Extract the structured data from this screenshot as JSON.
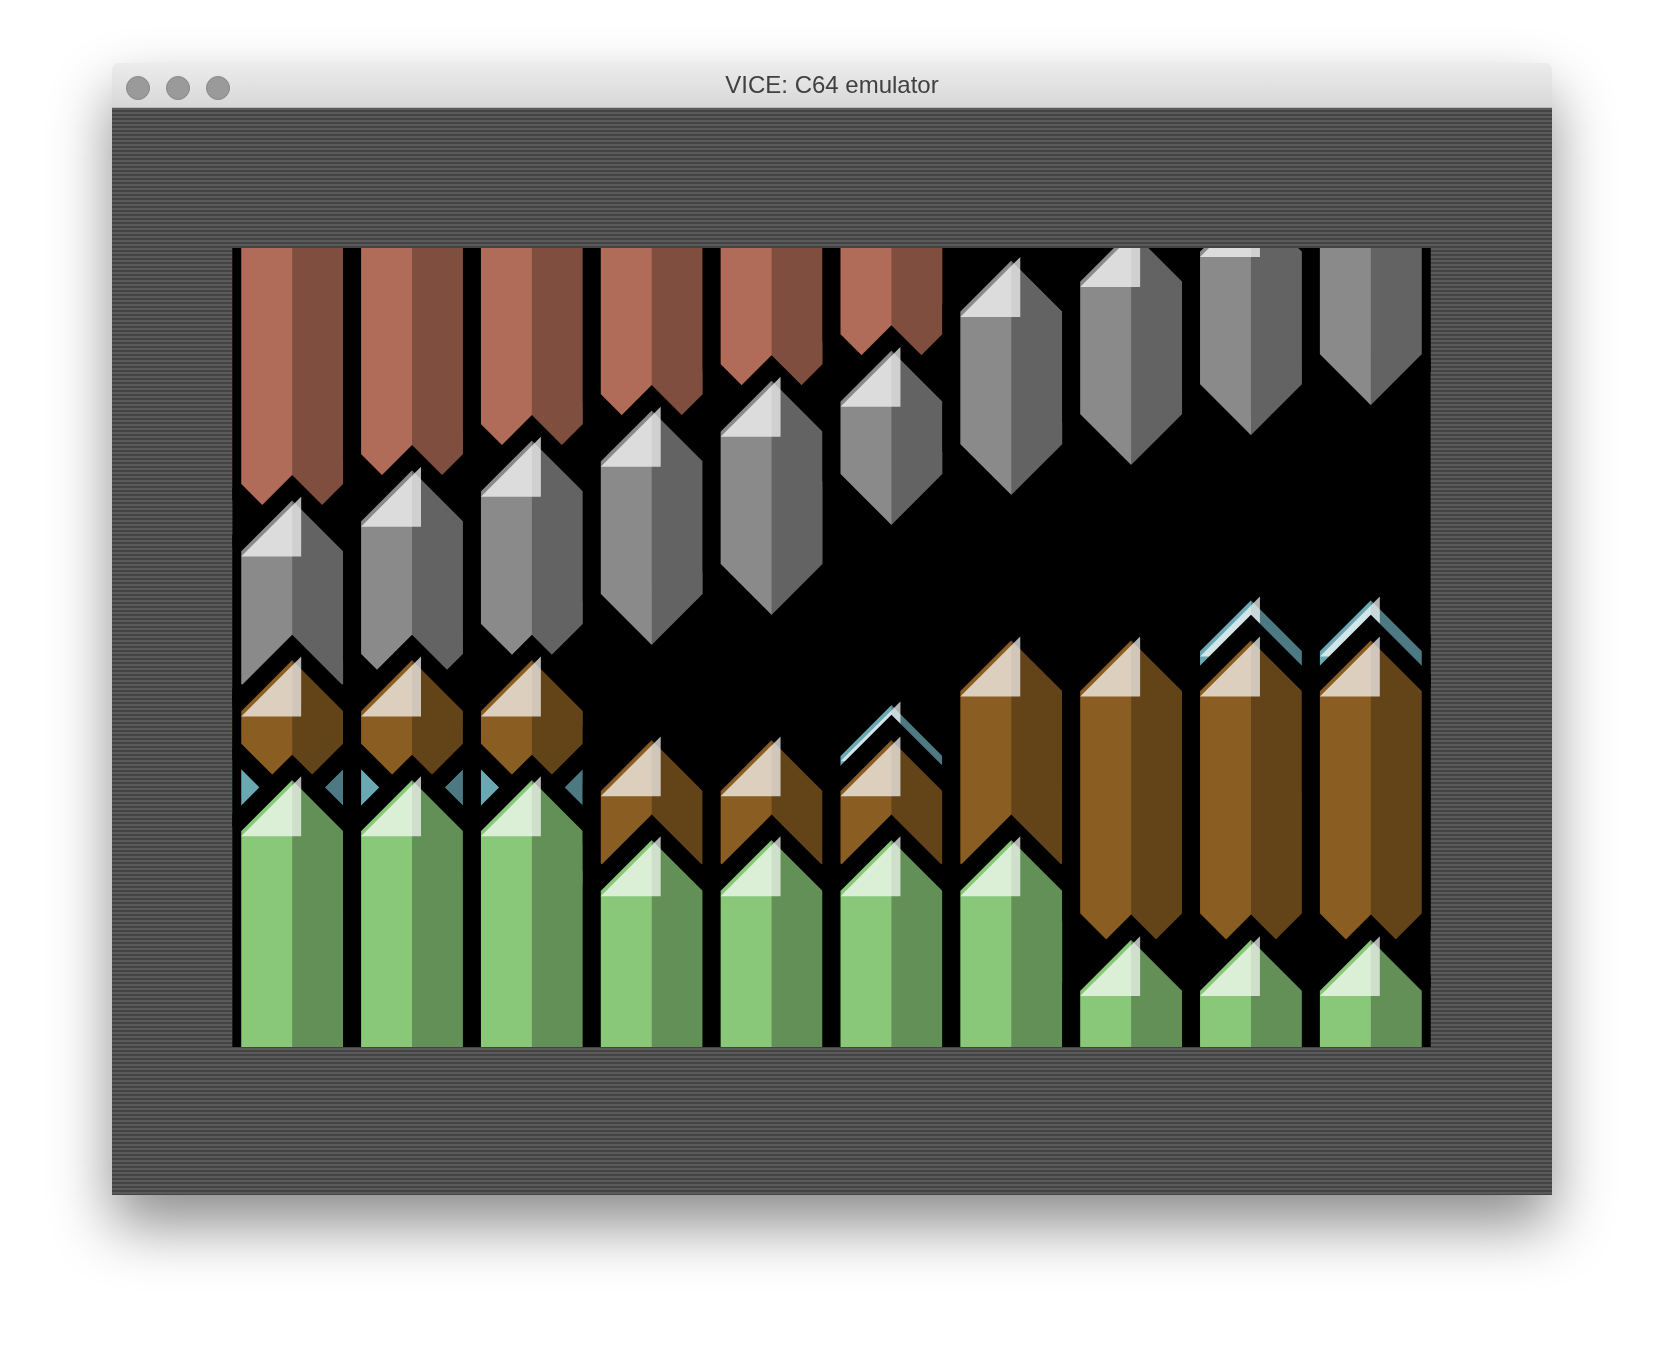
{
  "window": {
    "title": "VICE: C64 emulator"
  }
}
